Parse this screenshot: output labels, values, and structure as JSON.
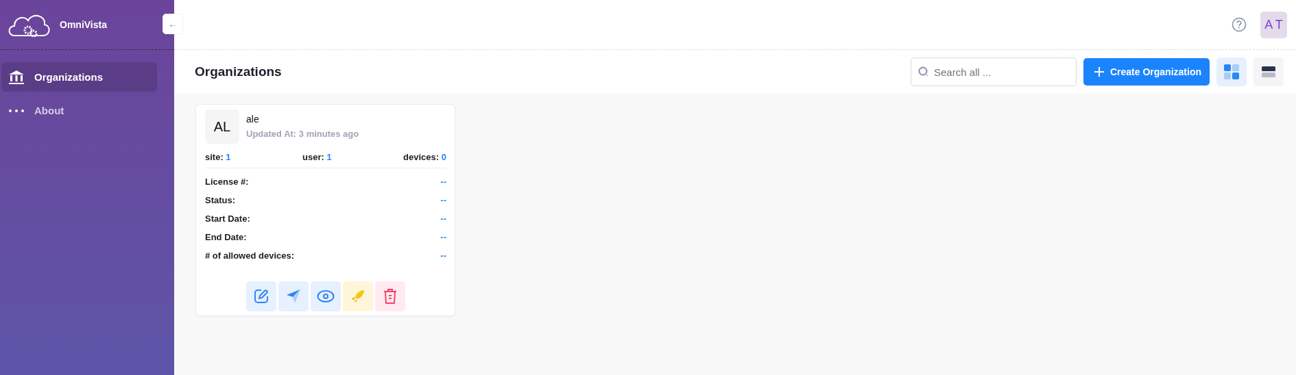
{
  "sidebar": {
    "brand": "OmniVista",
    "collapse_icon": "←",
    "items": [
      {
        "label": "Organizations",
        "kind": "bank",
        "selected": true
      },
      {
        "label": "About",
        "kind": "dots",
        "selected": false
      }
    ]
  },
  "header": {
    "avatar": "A T"
  },
  "page": {
    "title": "Organizations",
    "search": {
      "placeholder": "Search all ..."
    },
    "create_button": "Create Organization",
    "views": [
      {
        "kind": "grid",
        "selected": true
      },
      {
        "kind": "list",
        "selected": false
      }
    ]
  },
  "cards": [
    {
      "initials": "AL",
      "name": "ale",
      "updated": "Updated At: 3 minutes ago",
      "counts": [
        {
          "label": "site:",
          "value": "1"
        },
        {
          "label": "user:",
          "value": "1"
        },
        {
          "label": "devices:",
          "value": "0"
        }
      ],
      "fields": [
        {
          "label": "License #:",
          "value": "--"
        },
        {
          "label": "Status:",
          "value": "--"
        },
        {
          "label": "Start Date:",
          "value": "--"
        },
        {
          "label": "End Date:",
          "value": "--"
        },
        {
          "label": "# of allowed devices:",
          "value": "--"
        }
      ],
      "actions": [
        {
          "kind": "edit"
        },
        {
          "kind": "send"
        },
        {
          "kind": "view"
        },
        {
          "kind": "launch"
        },
        {
          "kind": "delete"
        }
      ]
    }
  ]
}
